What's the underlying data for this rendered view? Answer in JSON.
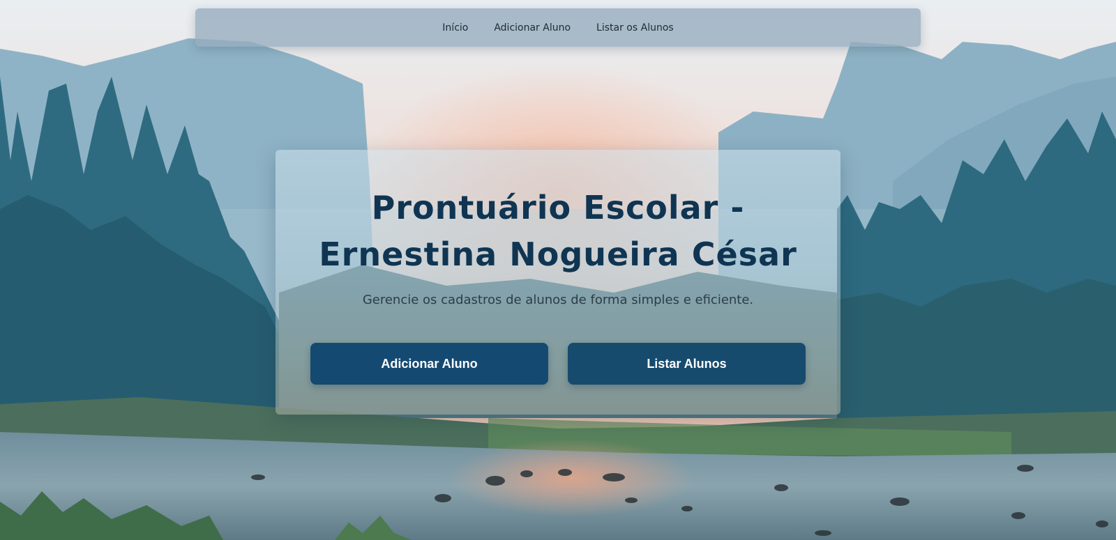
{
  "nav": {
    "items": [
      {
        "label": "Início"
      },
      {
        "label": "Adicionar Aluno"
      },
      {
        "label": "Listar os Alunos"
      }
    ]
  },
  "hero": {
    "title": "Prontuário Escolar - Ernestina Nogueira César",
    "subtitle": "Gerencie os cadastros de alunos de forma simples e eficiente.",
    "buttons": {
      "add_label": "Adicionar Aluno",
      "list_label": "Listar Alunos"
    }
  },
  "colors": {
    "title": "#0f3552",
    "button": "#144a72",
    "button_text": "#ffffff",
    "nav_bg": "#96acbe"
  }
}
